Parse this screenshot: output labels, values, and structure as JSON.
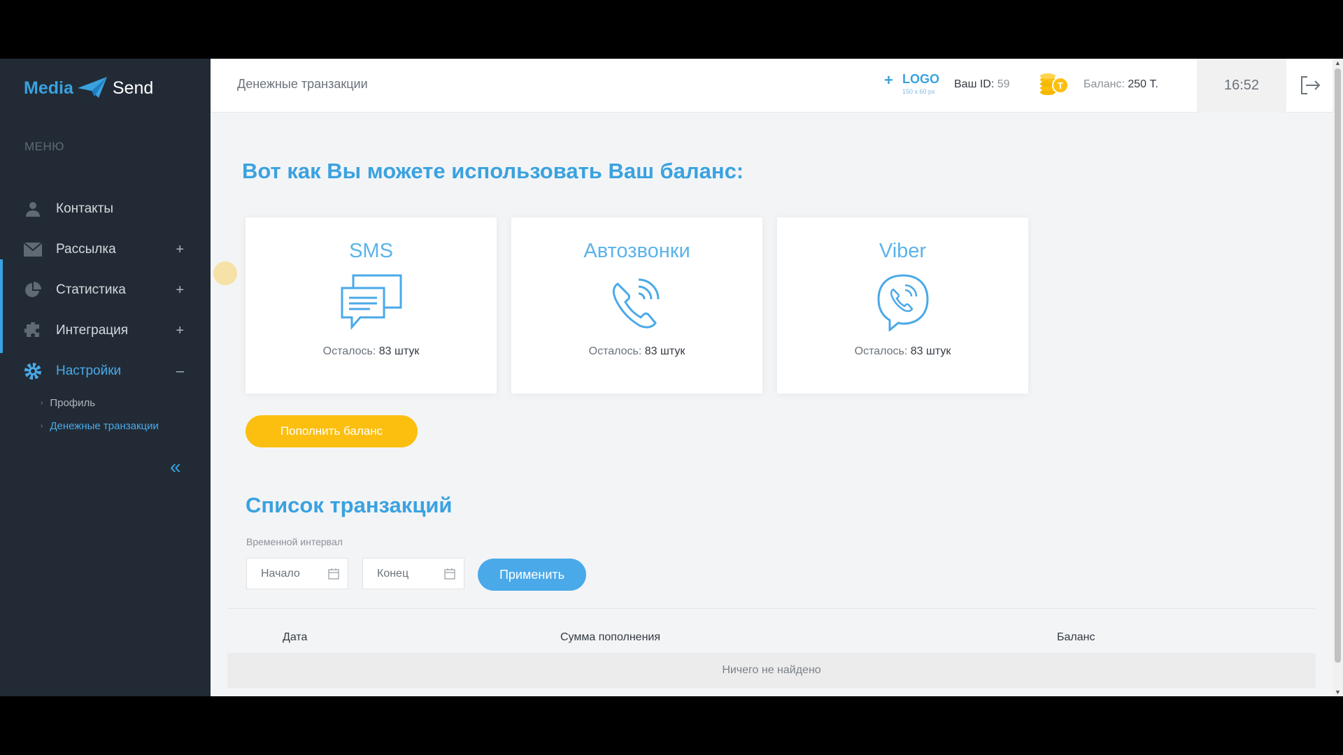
{
  "brand": {
    "part1": "Media",
    "part2": "Send"
  },
  "sidebar": {
    "caption": "МЕНЮ",
    "items": [
      {
        "label": "Контакты",
        "icon": "user-icon",
        "expand": ""
      },
      {
        "label": "Рассылка",
        "icon": "envelope-icon",
        "expand": "+"
      },
      {
        "label": "Статистика",
        "icon": "pie-chart-icon",
        "expand": "+"
      },
      {
        "label": "Интеграция",
        "icon": "puzzle-icon",
        "expand": "+"
      },
      {
        "label": "Настройки",
        "icon": "gear-icon",
        "expand": "–"
      }
    ],
    "sub_items": [
      "Профиль",
      "Денежные транзакции"
    ],
    "collapse_glyph": "«"
  },
  "topbar": {
    "title": "Денежные транзакции",
    "logo_plus": "+",
    "logo_text": "LOGO",
    "logo_size": "150 x 60 px",
    "id_label": "Ваш ID:",
    "id_value": "59",
    "balance_label": "Баланс:",
    "balance_value": "250 Т.",
    "time": "16:52"
  },
  "main": {
    "headline": "Вот как Вы можете использовать Ваш баланс:",
    "cards": [
      {
        "title": "SMS",
        "icon": "chat-bubbles-icon",
        "remain_label": "Осталось:",
        "remain_value": "83 штук"
      },
      {
        "title": "Автозвонки",
        "icon": "phone-icon",
        "remain_label": "Осталось:",
        "remain_value": "83 штук"
      },
      {
        "title": "Viber",
        "icon": "viber-icon",
        "remain_label": "Осталось:",
        "remain_value": "83 штук"
      }
    ],
    "topup_label": "Пополнить баланс",
    "list_title": "Список транзакций",
    "interval_label": "Временной интервал",
    "start_placeholder": "Начало",
    "end_placeholder": "Конец",
    "apply_label": "Применить",
    "table": {
      "columns": [
        "Дата",
        "Сумма пополнения",
        "Баланс"
      ],
      "empty": "Ничего не найдено"
    }
  },
  "colors": {
    "accent": "#3aa2e0",
    "topup": "#fcbf10",
    "sidebar": "#222b35"
  }
}
